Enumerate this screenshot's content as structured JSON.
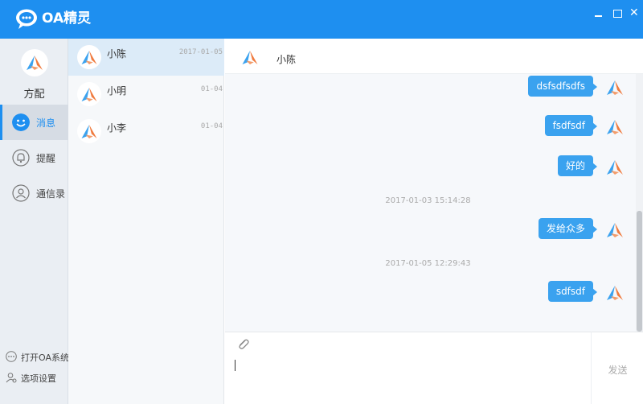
{
  "app": {
    "title": "OA精灵"
  },
  "nav": {
    "user_name": "方配",
    "items": [
      {
        "label": "消息",
        "icon": "smile-icon",
        "active": true
      },
      {
        "label": "提醒",
        "icon": "bell-icon",
        "active": false
      },
      {
        "label": "通信录",
        "icon": "contacts-icon",
        "active": false
      }
    ],
    "bottom": [
      {
        "label": "打开OA系统",
        "icon": "more-icon"
      },
      {
        "label": "选项设置",
        "icon": "settings-user-icon"
      }
    ]
  },
  "conversations": [
    {
      "name": "小陈",
      "date": "2017-01-05",
      "active": true
    },
    {
      "name": "小明",
      "date": "01-04",
      "active": false
    },
    {
      "name": "小李",
      "date": "01-04",
      "active": false
    }
  ],
  "chat": {
    "title": "小陈",
    "messages": [
      {
        "type": "msg",
        "text": "dsfsdfsdfs"
      },
      {
        "type": "msg",
        "text": "fsdfsdf"
      },
      {
        "type": "msg",
        "text": "好的"
      },
      {
        "type": "time",
        "text": "2017-01-03 15:14:28"
      },
      {
        "type": "msg",
        "text": "发给众多"
      },
      {
        "type": "time",
        "text": "2017-01-05 12:29:43"
      },
      {
        "type": "msg",
        "text": "sdfsdf"
      }
    ],
    "send_label": "发送"
  },
  "colors": {
    "accent": "#1e8ff0",
    "bubble": "#3aa2ef"
  }
}
